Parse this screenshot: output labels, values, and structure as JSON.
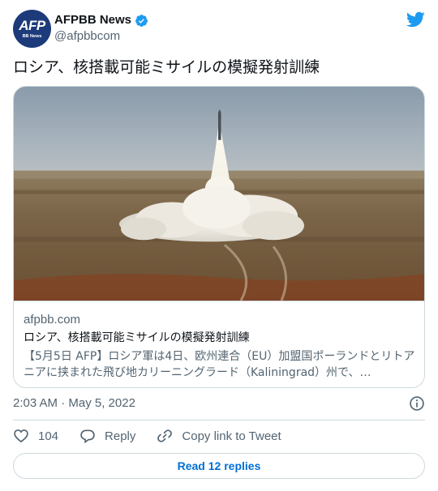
{
  "account": {
    "name": "AFPBB News",
    "handle": "@afpbbcom",
    "avatar_text": "AFP",
    "avatar_subtext": "BB News",
    "verified": true
  },
  "tweet": {
    "text": "ロシア、核搭載可能ミサイルの模擬発射訓練",
    "timestamp": "2:03 AM · May 5, 2022"
  },
  "card": {
    "domain": "afpbb.com",
    "title": "ロシア、核搭載可能ミサイルの模擬発射訓練",
    "description": "【5月5日 AFP】ロシア軍は4日、欧州連合（EU）加盟国ポーランドとリトアニアに挟まれた飛び地カリーニングラード（Kaliningrad）州で、…",
    "image_icon": "missile-launch-photo"
  },
  "actions": {
    "like_count": "104",
    "reply_label": "Reply",
    "copy_label": "Copy link to Tweet"
  },
  "read_replies": {
    "label": "Read 12 replies"
  },
  "colors": {
    "brand_blue": "#1d9bf0",
    "link_blue": "#006fd6",
    "muted": "#536471",
    "border": "#cfd9de"
  }
}
